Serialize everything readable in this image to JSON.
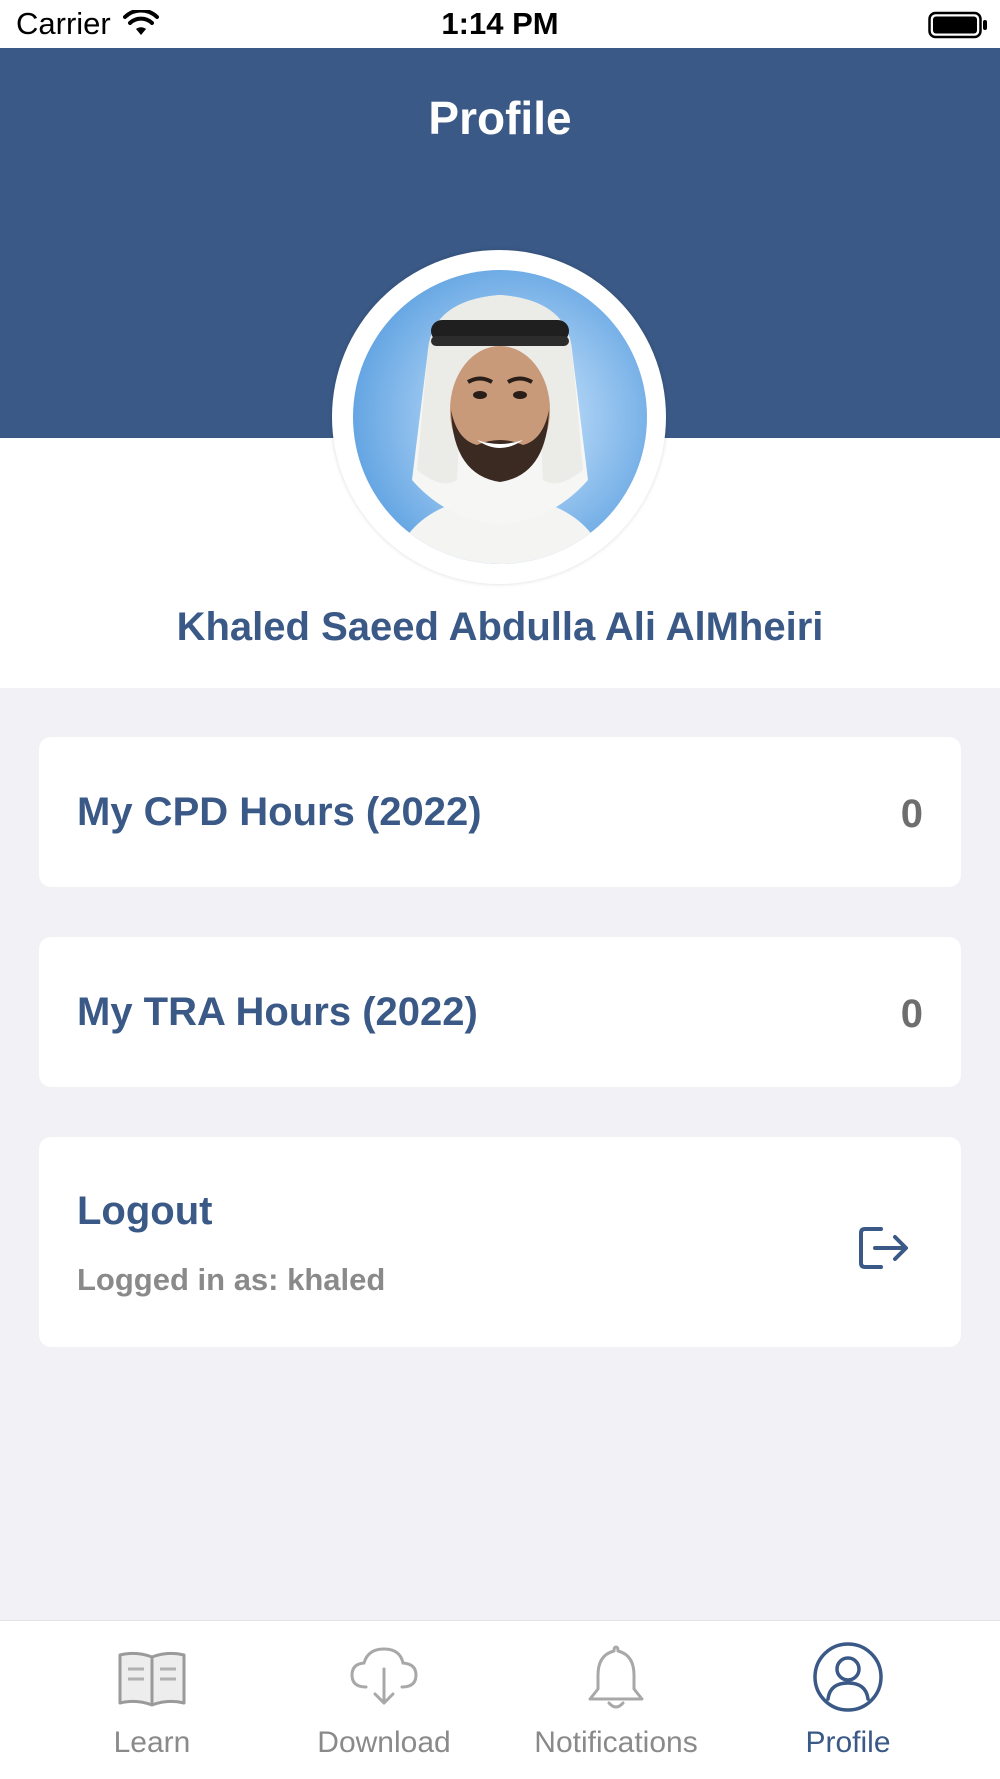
{
  "status_bar": {
    "carrier": "Carrier",
    "time": "1:14 PM",
    "wifi_icon": "wifi-icon",
    "battery_icon": "battery-icon"
  },
  "header": {
    "title": "Profile",
    "background_color": "#3a5986"
  },
  "profile": {
    "name": "Khaled Saeed Abdulla Ali AlMheiri",
    "avatar": "avatar-photo"
  },
  "cards": {
    "cpd": {
      "label": "My CPD Hours (2022)",
      "value": "0"
    },
    "tra": {
      "label": "My TRA Hours (2022)",
      "value": "0"
    },
    "logout": {
      "label": "Logout",
      "subtitle": "Logged in as: khaled",
      "icon": "logout-icon"
    }
  },
  "tab_bar": {
    "tabs": [
      {
        "label": "Learn",
        "icon": "book-icon",
        "active": false
      },
      {
        "label": "Download",
        "icon": "cloud-download-icon",
        "active": false
      },
      {
        "label": "Notifications",
        "icon": "bell-icon",
        "active": false
      },
      {
        "label": "Profile",
        "icon": "user-circle-icon",
        "active": true
      }
    ]
  },
  "colors": {
    "accent": "#3a5986",
    "page_background": "#f1f1f6",
    "inactive": "#8a8a8a"
  }
}
